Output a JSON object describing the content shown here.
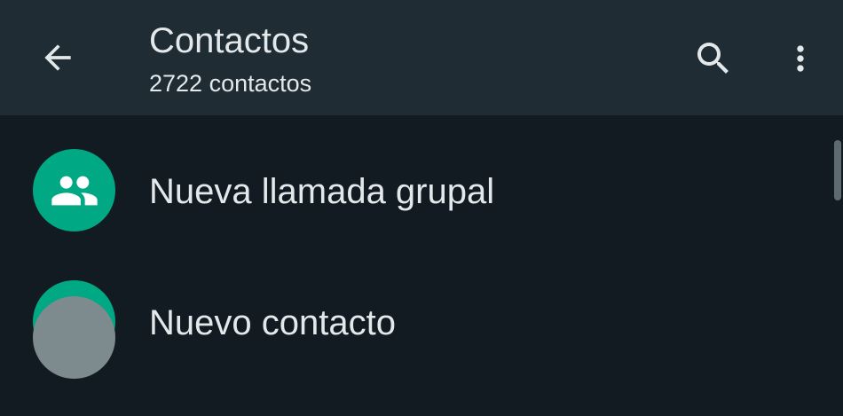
{
  "header": {
    "title": "Contactos",
    "subtitle": "2722 contactos",
    "back_icon": "arrow-back-icon",
    "search_icon": "search-icon",
    "menu_icon": "more-vert-icon"
  },
  "list": {
    "items": [
      {
        "label": "Nueva llamada grupal",
        "icon": "group-icon"
      },
      {
        "label": "Nuevo contacto",
        "icon": "person-add-icon"
      }
    ]
  },
  "colors": {
    "app_bar": "#1f2c34",
    "background": "#121b22",
    "accent": "#00a884",
    "text": "#e3e8ea"
  }
}
